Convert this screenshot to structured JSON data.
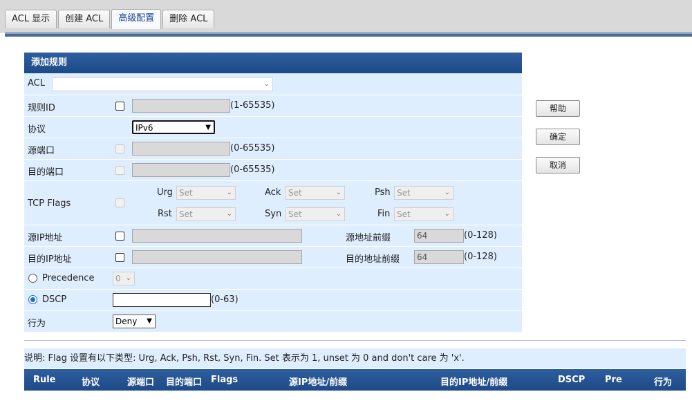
{
  "tabs": [
    {
      "label": "ACL 显示",
      "active": false
    },
    {
      "label": "创建 ACL",
      "active": false
    },
    {
      "label": "高级配置",
      "active": true
    },
    {
      "label": "删除 ACL",
      "active": false
    }
  ],
  "panel": {
    "title": "添加规则",
    "acl_label": "ACL",
    "acl_value": "",
    "rule_id_label": "规则ID",
    "rule_id_range": "(1-65535)",
    "protocol_label": "协议",
    "protocol_value": "IPv6",
    "src_port_label": "源端口",
    "src_port_range": "(0-65535)",
    "dst_port_label": "目的端口",
    "dst_port_range": "(0-65535)",
    "tcp_flags_label": "TCP Flags",
    "flags": {
      "urg": {
        "label": "Urg",
        "value": "Set"
      },
      "ack": {
        "label": "Ack",
        "value": "Set"
      },
      "psh": {
        "label": "Psh",
        "value": "Set"
      },
      "rst": {
        "label": "Rst",
        "value": "Set"
      },
      "syn": {
        "label": "Syn",
        "value": "Set"
      },
      "fin": {
        "label": "Fin",
        "value": "Set"
      }
    },
    "src_ip_label": "源IP地址",
    "src_prefix_label": "源地址前缀",
    "src_prefix_value": "64",
    "src_prefix_range": "(0-128)",
    "dst_ip_label": "目的IP地址",
    "dst_prefix_label": "目的地址前缀",
    "dst_prefix_value": "64",
    "dst_prefix_range": "(0-128)",
    "precedence_label": "Precedence",
    "precedence_value": "0",
    "dscp_label": "DSCP",
    "dscp_value": "",
    "dscp_range": "(0-63)",
    "action_label": "行为",
    "action_value": "Deny"
  },
  "buttons": {
    "help": "帮助",
    "ok": "确定",
    "cancel": "取消"
  },
  "note": "说明: Flag 设置有以下类型: Urg, Ack, Psh, Rst, Syn, Fin. Set 表示为 1, unset 为 0 and don't care 为 'x'.",
  "table_headers": [
    "Rule",
    "协议",
    "源端口",
    "目的端口",
    "Flags",
    "源IP地址/前缀",
    "目的IP地址/前缀",
    "DSCP",
    "Pre",
    "行为"
  ]
}
